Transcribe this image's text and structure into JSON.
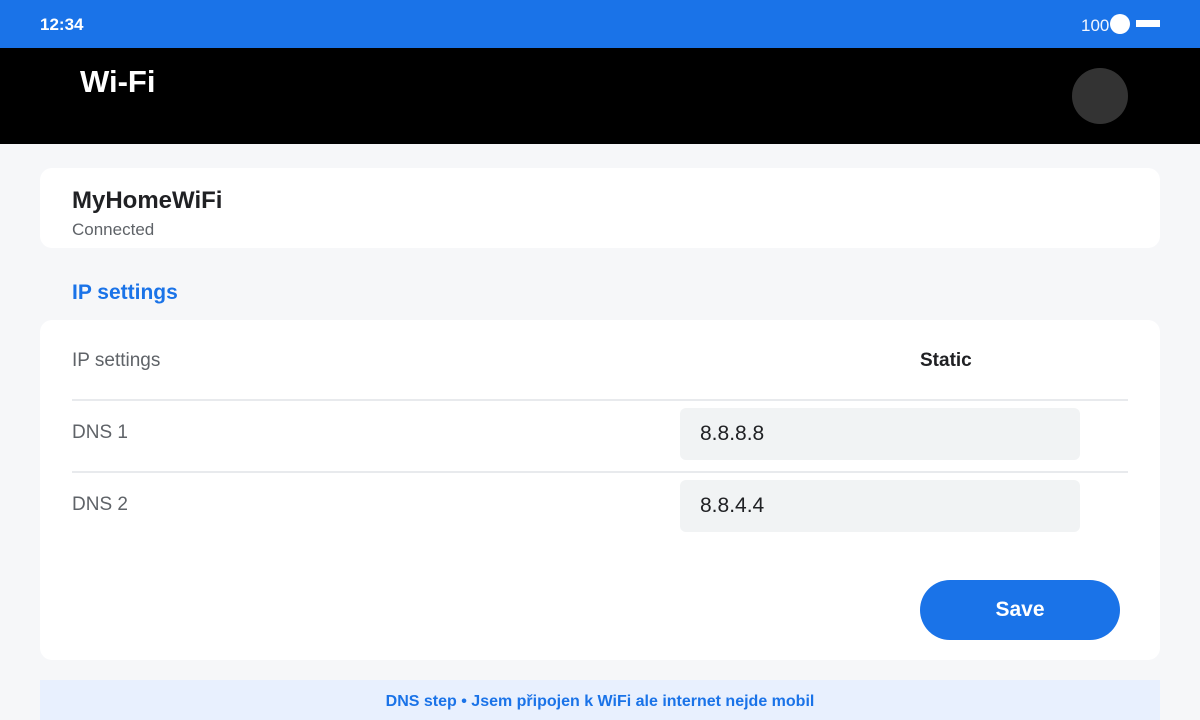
{
  "status_bar": {
    "time": "12:34",
    "battery_level": "100",
    "accent_color": "#1a73e8"
  },
  "app_bar": {
    "title": "Wi-Fi",
    "avatar_icon": "avatar"
  },
  "network": {
    "name": "MyHomeWiFi",
    "status": "Connected"
  },
  "ip_section": {
    "heading": "IP settings",
    "mode_label": "IP settings",
    "mode_value": "Static",
    "dns1": {
      "label": "DNS 1",
      "value": "8.8.8.8"
    },
    "dns2": {
      "label": "DNS 2",
      "value": "8.8.4.4"
    },
    "save_label": "Save"
  },
  "footer": {
    "banner_text": "DNS step • Jsem připojen k WiFi ale internet nejde mobil"
  }
}
